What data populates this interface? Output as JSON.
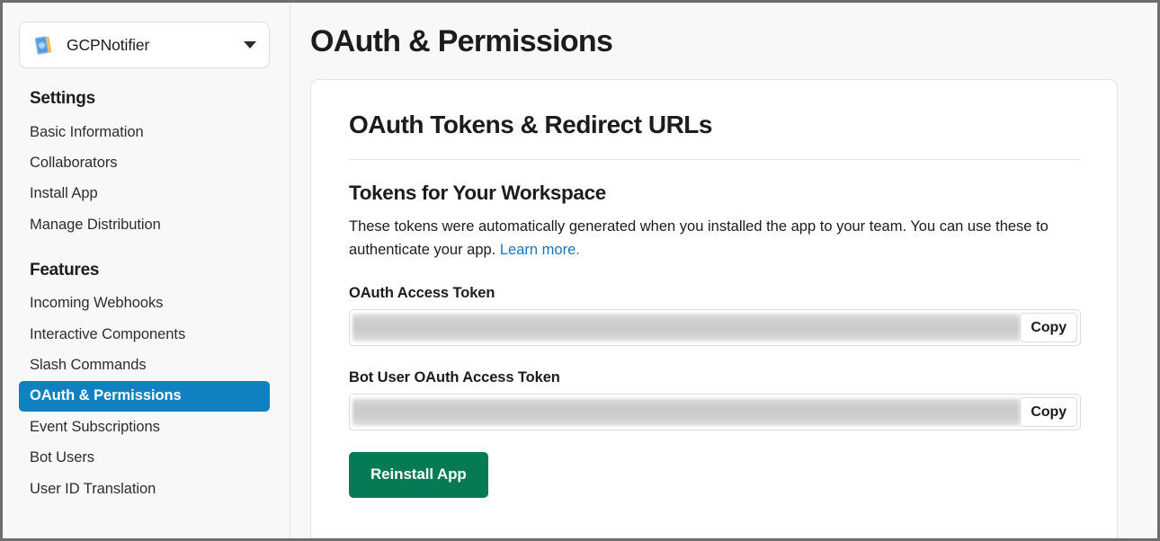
{
  "sidebar": {
    "app_switcher": {
      "app_name": "GCPNotifier",
      "icon": "slack-app-icon",
      "chevron": "chevron-down-icon"
    },
    "groups": [
      {
        "heading": "Settings",
        "items": [
          {
            "label": "Basic Information",
            "active": false
          },
          {
            "label": "Collaborators",
            "active": false
          },
          {
            "label": "Install App",
            "active": false
          },
          {
            "label": "Manage Distribution",
            "active": false
          }
        ]
      },
      {
        "heading": "Features",
        "items": [
          {
            "label": "Incoming Webhooks",
            "active": false
          },
          {
            "label": "Interactive Components",
            "active": false
          },
          {
            "label": "Slash Commands",
            "active": false
          },
          {
            "label": "OAuth & Permissions",
            "active": true
          },
          {
            "label": "Event Subscriptions",
            "active": false
          },
          {
            "label": "Bot Users",
            "active": false
          },
          {
            "label": "User ID Translation",
            "active": false
          }
        ]
      }
    ]
  },
  "main": {
    "page_title": "OAuth & Permissions",
    "card": {
      "title": "OAuth Tokens & Redirect URLs",
      "section_title": "Tokens for Your Workspace",
      "description_text": "These tokens were automatically generated when you installed the app to your team. You can use these to authenticate your app. ",
      "description_link": "Learn more.",
      "fields": [
        {
          "label": "OAuth Access Token",
          "value": "",
          "redacted": true,
          "copy_label": "Copy"
        },
        {
          "label": "Bot User OAuth Access Token",
          "value": "",
          "redacted": true,
          "copy_label": "Copy"
        }
      ],
      "primary_button": "Reinstall App"
    }
  },
  "colors": {
    "active_nav": "#1081c0",
    "link": "#1d74ba",
    "primary_button": "#067a54",
    "page_bg": "#f8f8f8",
    "card_bg": "#ffffff",
    "border": "#e3e3e3"
  }
}
